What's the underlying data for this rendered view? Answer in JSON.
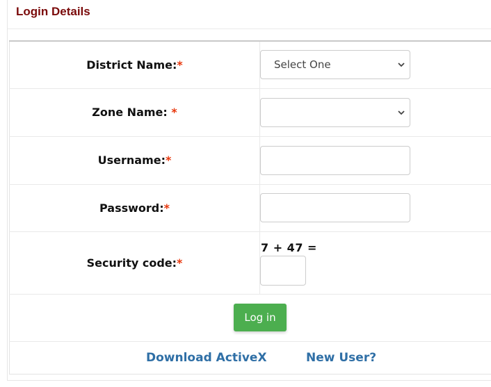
{
  "panel": {
    "title": "Login Details"
  },
  "form": {
    "district": {
      "label": "District Name:",
      "required_mark": "*",
      "selected": "Select One"
    },
    "zone": {
      "label": "Zone Name: ",
      "required_mark": "*",
      "selected": ""
    },
    "username": {
      "label": "Username:",
      "required_mark": "*",
      "value": ""
    },
    "password": {
      "label": "Password:",
      "required_mark": "*",
      "value": ""
    },
    "security": {
      "label": "Security code:",
      "required_mark": "*",
      "question": "7 + 47 =",
      "value": ""
    },
    "login_button": "Log in"
  },
  "links": {
    "download_activex": "Download ActiveX",
    "new_user": "New User?"
  },
  "colors": {
    "title": "#7a0a0a",
    "required": "#e8380d",
    "button": "#4cae4f",
    "link": "#2f6fa6"
  }
}
